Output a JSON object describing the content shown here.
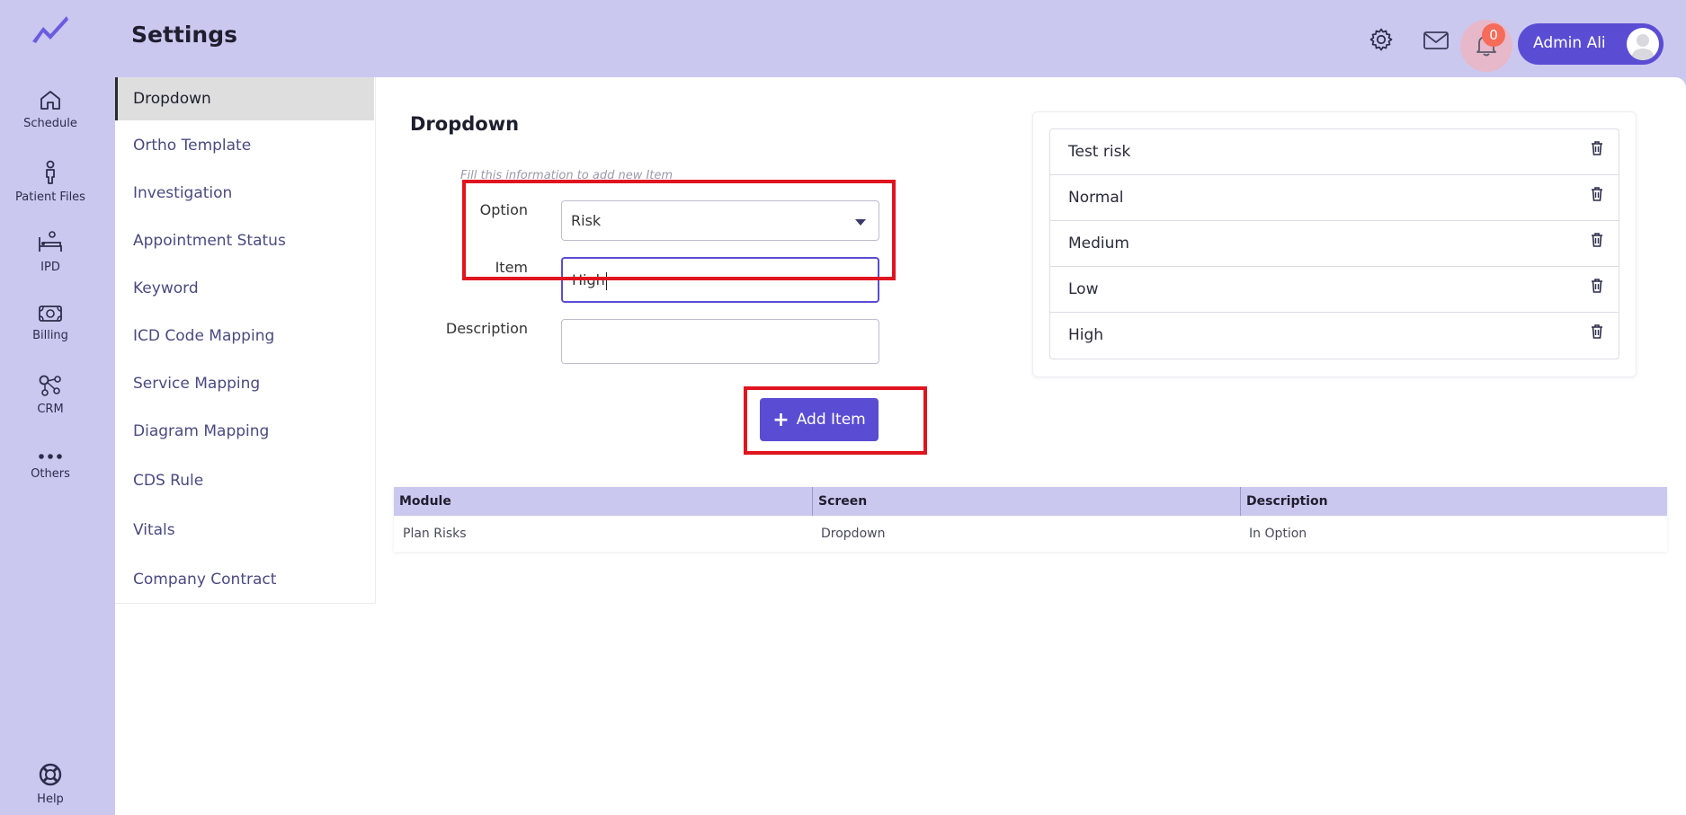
{
  "header": {
    "title": "Settings",
    "user_name": "Admin Ali",
    "notification_count": "0"
  },
  "rail": {
    "items": [
      {
        "label": "Schedule",
        "icon": "home-icon"
      },
      {
        "label": "Patient Files",
        "icon": "person-icon"
      },
      {
        "label": "IPD",
        "icon": "bed-icon"
      },
      {
        "label": "Billing",
        "icon": "money-icon"
      },
      {
        "label": "CRM",
        "icon": "network-icon"
      },
      {
        "label": "Others",
        "icon": "more-icon"
      }
    ],
    "help_label": "Help"
  },
  "settings_nav": {
    "items": [
      {
        "label": "Dropdown",
        "active": true
      },
      {
        "label": "Ortho Template"
      },
      {
        "label": "Investigation"
      },
      {
        "label": "Appointment Status"
      },
      {
        "label": "Keyword"
      },
      {
        "label": "ICD Code Mapping"
      },
      {
        "label": "Service Mapping"
      },
      {
        "label": "Diagram Mapping"
      },
      {
        "label": "CDS Rule"
      },
      {
        "label": "Vitals"
      },
      {
        "label": "Company Contract"
      }
    ]
  },
  "form": {
    "title": "Dropdown",
    "hint": "Fill this information to add new Item",
    "option_label": "Option",
    "option_value": "Risk",
    "item_label": "Item",
    "item_value": "High",
    "description_label": "Description",
    "description_value": "",
    "add_button_label": "Add Item"
  },
  "items_list": [
    "Test risk",
    "Normal",
    "Medium",
    "Low",
    "High"
  ],
  "table": {
    "headers": [
      "Module",
      "Screen",
      "Description"
    ],
    "rows": [
      [
        "Plan Risks",
        "Dropdown",
        "In Option"
      ]
    ]
  },
  "colors": {
    "accent": "#5a4dd3",
    "background": "#cbc8f0",
    "highlight": "#e0141e",
    "badge": "#f76b5a"
  }
}
